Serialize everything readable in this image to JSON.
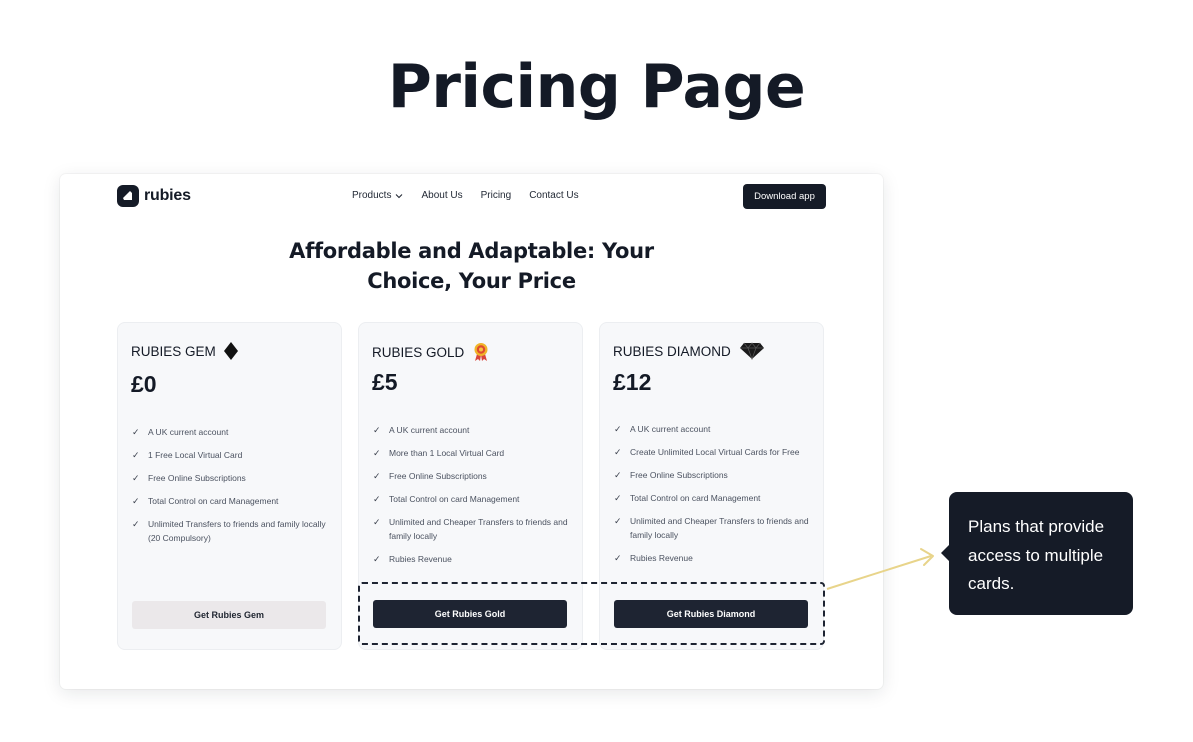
{
  "page": {
    "title": "Pricing Page"
  },
  "navbar": {
    "brand": "rubies",
    "items": [
      {
        "label": "Products",
        "has_dropdown": true
      },
      {
        "label": "About Us"
      },
      {
        "label": "Pricing"
      },
      {
        "label": "Contact Us"
      }
    ],
    "download_label": "Download app"
  },
  "hero": {
    "line1": "Affordable and Adaptable: Your",
    "line2": "Choice, Your Price"
  },
  "plans": [
    {
      "name": "RUBIES GEM",
      "icon": "black-diamond-icon",
      "price": "£0",
      "features": [
        "A UK current account",
        "1 Free Local Virtual Card",
        "Free Online Subscriptions",
        "Total Control on card Management",
        "Unlimited Transfers to friends and family locally (20 Compulsory)"
      ],
      "button": "Get Rubies Gem",
      "button_style": "light"
    },
    {
      "name": "RUBIES GOLD",
      "icon": "gold-medal-icon",
      "price": "£5",
      "features": [
        "A UK current account",
        "More than 1 Local Virtual Card",
        "Free Online Subscriptions",
        "Total Control on card Management",
        "Unlimited and Cheaper Transfers to friends and family locally",
        "Rubies Revenue"
      ],
      "button": "Get Rubies Gold",
      "button_style": "dark"
    },
    {
      "name": "RUBIES DIAMOND",
      "icon": "black-gem-icon",
      "price": "£12",
      "features": [
        "A UK current account",
        "Create Unlimited Local Virtual Cards for Free",
        "Free Online Subscriptions",
        "Total Control on card Management",
        "Unlimited and Cheaper Transfers to friends and family locally",
        "Rubies Revenue"
      ],
      "button": "Get Rubies Diamond",
      "button_style": "dark"
    }
  ],
  "annotation": {
    "text": "Plans that provide access to multiple cards."
  },
  "colors": {
    "dark": "#151b27",
    "card_bg": "#f7f8fa",
    "light_button": "#ebe8ea",
    "connector": "#e8d48a"
  }
}
